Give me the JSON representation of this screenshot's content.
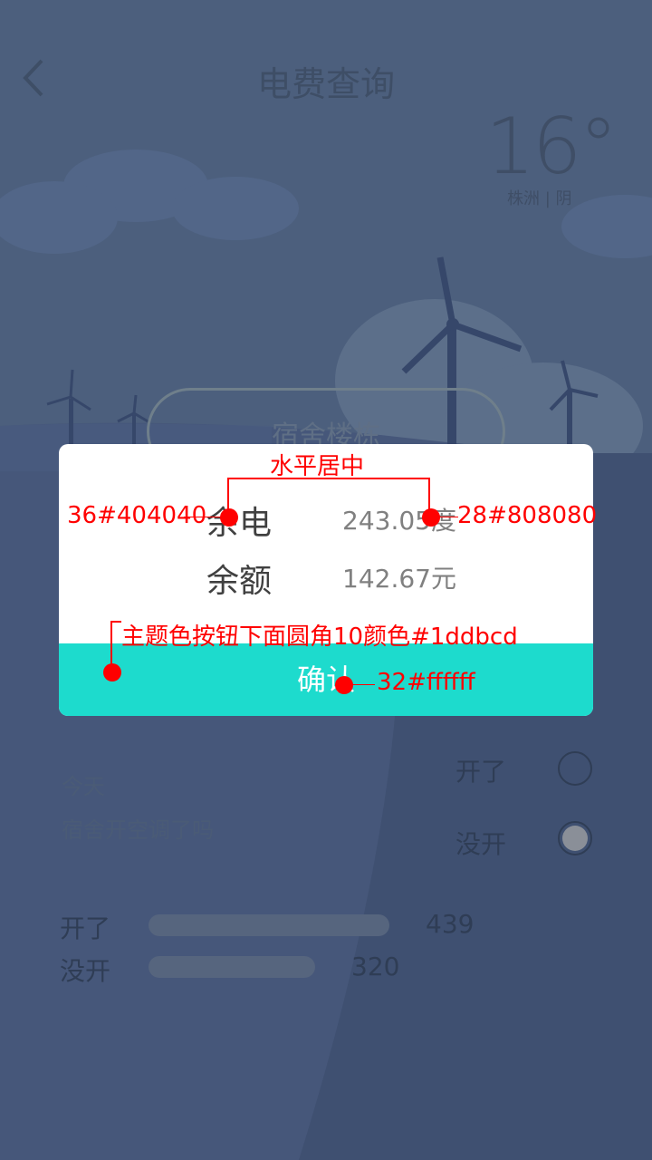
{
  "header": {
    "title": "电费查询"
  },
  "weather": {
    "temperature": "16°",
    "location": "株洲 | 阴"
  },
  "dorm_selector": {
    "label": "宿舍楼栋"
  },
  "dialog": {
    "rows": [
      {
        "label": "余电",
        "value": "243.05度"
      },
      {
        "label": "余额",
        "value": "142.67元"
      }
    ],
    "confirm_label": "确认"
  },
  "survey": {
    "question_line1": "今天",
    "question_line2": "宿舍开空调了吗",
    "options": [
      "开了",
      "没开"
    ],
    "selected_option": "没开"
  },
  "stats": [
    {
      "label": "开了",
      "value": "439"
    },
    {
      "label": "没开",
      "value": "320"
    }
  ],
  "annotations": {
    "center_note": "水平居中",
    "label_style": "36#404040",
    "value_style": "28#808080",
    "button_note": "主题色按钮下面圆角10颜色#1ddbcd",
    "button_text_style": "32#ffffff"
  },
  "colors": {
    "accent": "#1ddbcd",
    "label_text": "#404040",
    "value_text": "#808080",
    "annotation": "#ff0000"
  }
}
